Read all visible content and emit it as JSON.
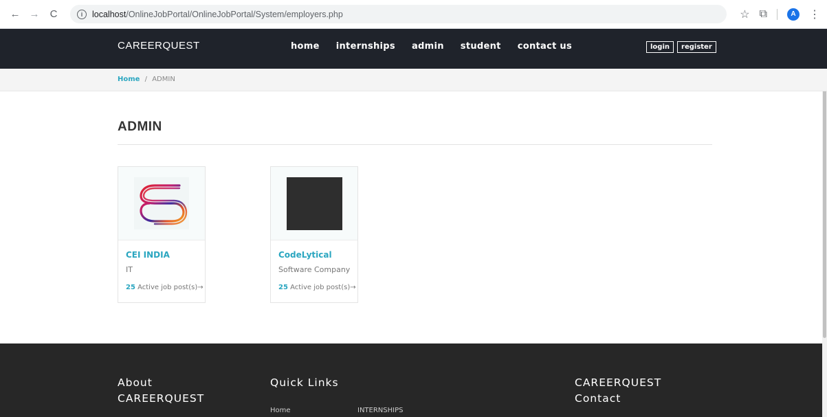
{
  "browser": {
    "url_domain": "localhost",
    "url_path": "/OnlineJobPortal/OnlineJobPortal/System/employers.php",
    "profile_initial": "A"
  },
  "header": {
    "brand": "CAREERQUEST",
    "nav": [
      "home",
      "internships",
      "admin",
      "student",
      "contact us"
    ],
    "login_label": "login",
    "register_label": "register"
  },
  "breadcrumb": {
    "home": "Home",
    "separator": "/",
    "current": "ADMIN"
  },
  "page": {
    "title": "ADMIN"
  },
  "employers": [
    {
      "name": "CEI INDIA",
      "industry": "IT",
      "job_count": "25",
      "job_label": " Active job post(s)→",
      "logo": "cei-logo-icon"
    },
    {
      "name": "CodeLytical",
      "industry": "Software Company",
      "job_count": "25",
      "job_label": " Active job post(s)→",
      "logo": "codelytical-poem-image"
    }
  ],
  "footer": {
    "about_title_1": "About",
    "about_title_2": "CAREERQUEST",
    "quick_links_title": "Quick Links",
    "contact_title_1": "CAREERQUEST",
    "contact_title_2": "Contact",
    "links": [
      "Home",
      "INTERNSHIPS"
    ]
  },
  "colors": {
    "header_bg": "#1f232b",
    "accent": "#2aa6c0",
    "footer_bg": "#272727"
  }
}
